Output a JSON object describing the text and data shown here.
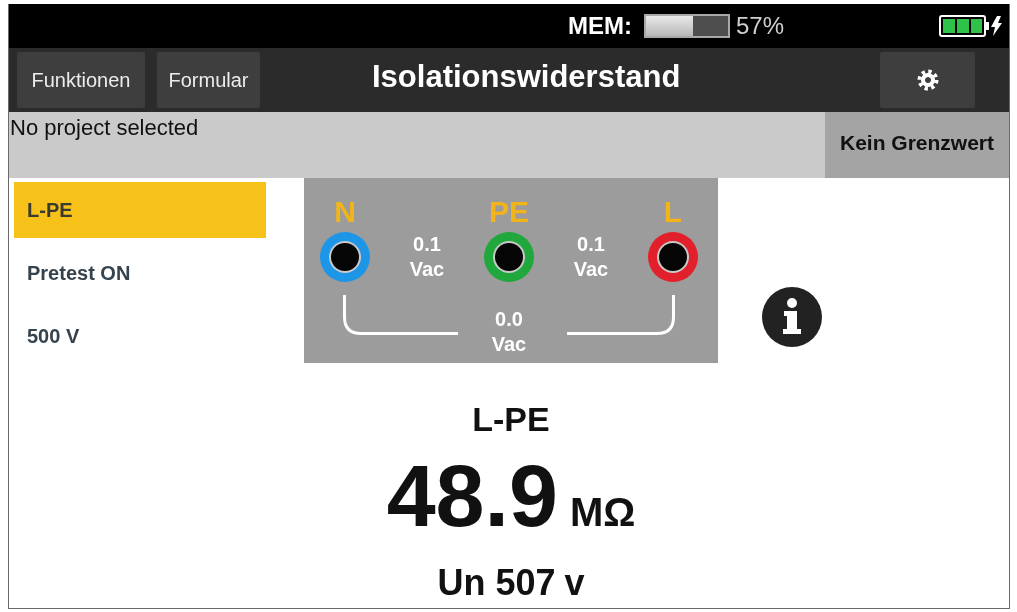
{
  "status_bar": {
    "memory_label": "MEM:",
    "memory": {
      "level": 0.57
    },
    "memory_reading": "57%"
  },
  "header": {
    "buttons": [
      "Funktionen",
      "Formular"
    ],
    "title": "Isolationswiderstand"
  },
  "info_bar": {
    "project": "No project selected",
    "limit": "Kein Grenzwert"
  },
  "settings": [
    {
      "label": "L-PE",
      "selected": true
    },
    {
      "label": "Pretest ON",
      "selected": false
    },
    {
      "label": "500 V",
      "selected": false
    }
  ],
  "diagram": {
    "terminals": [
      {
        "label": "N",
        "color": "#1e96e8"
      },
      {
        "label": "PE",
        "color": "#20a83c"
      },
      {
        "label": "L",
        "color": "#e2202c"
      }
    ],
    "readings": [
      "0.1 Vac",
      "0.1 Vac",
      "0.0 Vac"
    ]
  },
  "measurement": {
    "circuit": "L-PE",
    "value": "48.9",
    "unit": "MΩ",
    "test_voltage": "Un 507",
    "test_voltage_unit": "v"
  }
}
